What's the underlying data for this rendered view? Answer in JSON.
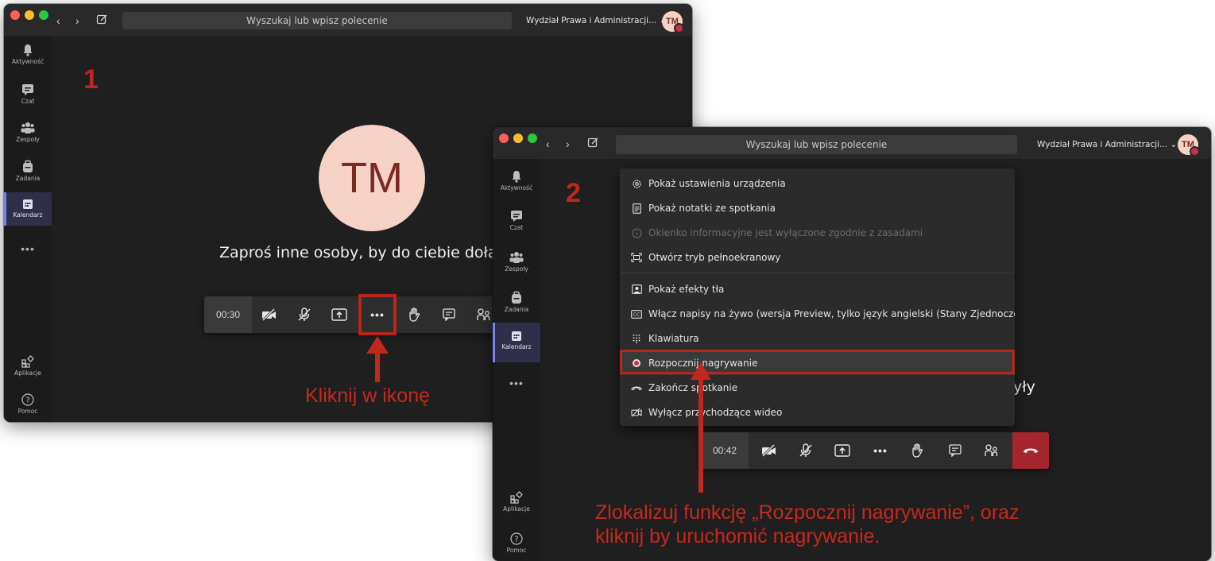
{
  "colors": {
    "annotation_red": "#c0281d",
    "window_bg": "#1f1f1f",
    "avatar_bg": "#f6d2c6",
    "active_rail": "#7b83eb",
    "hangup": "#a4262c"
  },
  "window1": {
    "search_placeholder": "Wyszukaj lub wpisz polecenie",
    "org_name": "Wydział Prawa i Administracji...",
    "user_initials": "TM",
    "rail": {
      "activity": "Aktywność",
      "chat": "Czat",
      "teams": "Zespoły",
      "assignments": "Zadania",
      "calendar": "Kalendarz",
      "more": "•••",
      "apps": "Aplikacje",
      "help": "Pomoc"
    },
    "step_number": "1",
    "avatar_initials": "TM",
    "invite_text": "Zaproś inne osoby, by do ciebie dołąc",
    "timer": "00:30",
    "more_button": "•••",
    "instruction": "Kliknij w ikonę"
  },
  "window2": {
    "search_placeholder": "Wyszukaj lub wpisz polecenie",
    "org_name": "Wydział Prawa i Administracji...",
    "user_initials": "TM",
    "rail": {
      "activity": "Aktywność",
      "chat": "Czat",
      "teams": "Zespoły",
      "assignments": "Zadania",
      "calendar": "Kalendarz",
      "more": "•••",
      "apps": "Aplikacje",
      "help": "Pomoc"
    },
    "step_number": "2",
    "behind_text": "yły",
    "menu": {
      "device_settings": "Pokaż ustawienia urządzenia",
      "meeting_notes": "Pokaż notatki ze spotkania",
      "info_disabled": "Okienko informacyjne jest wyłączone zgodnie z zasadami",
      "fullscreen": "Otwórz tryb pełnoekranowy",
      "bg_effects": "Pokaż efekty tła",
      "live_captions": "Włącz napisy na żywo (wersja Preview, tylko język angielski (Stany Zjednoczone))",
      "keypad": "Klawiatura",
      "start_recording": "Rozpocznij nagrywanie",
      "end_meeting": "Zakończ spotkanie",
      "disable_video": "Wyłącz przychodzące wideo"
    },
    "timer": "00:42",
    "more_button": "•••",
    "instruction_line1": "Zlokalizuj funkcję „Rozpocznij nagrywanie”, oraz",
    "instruction_line2": "kliknij by uruchomić nagrywanie."
  }
}
